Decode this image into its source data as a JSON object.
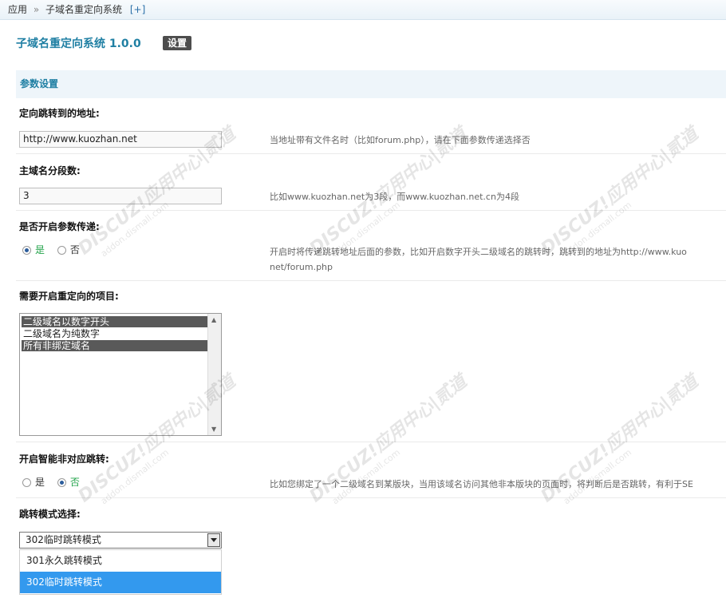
{
  "breadcrumb": {
    "root": "应用",
    "separator": "»",
    "current": "子域名重定向系统",
    "add": "[+]"
  },
  "header": {
    "title": "子域名重定向系统 1.0.0",
    "settings_label": "设置"
  },
  "section": {
    "title": "参数设置"
  },
  "fields": {
    "redirect_url": {
      "label": "定向跳转到的地址:",
      "value": "http://www.kuozhan.net",
      "hint": "当地址带有文件名时（比如forum.php），请在下面参数传递选择否"
    },
    "domain_segments": {
      "label": "主域名分段数:",
      "value": "3",
      "hint": "比如www.kuozhan.net为3段，而www.kuozhan.net.cn为4段"
    },
    "pass_params": {
      "label": "是否开启参数传递:",
      "yes": "是",
      "no": "否",
      "hint_line1": "开启时将传递跳转地址后面的参数，比如开启数字开头二级域名的跳转时，跳转到的地址为http://www.kuo",
      "hint_line2": "net/forum.php"
    },
    "redirect_items": {
      "label": "需要开启重定向的项目:",
      "options": [
        "二级域名以数字开头",
        "二级域名为纯数字",
        "所有非绑定域名"
      ]
    },
    "smart_redirect": {
      "label": "开启智能非对应跳转:",
      "yes": "是",
      "no": "否",
      "hint": "比如您绑定了一个二级域名到某版块，当用该域名访问其他非本版块的页面时，将判断后是否跳转，有利于SE"
    },
    "redirect_mode": {
      "label": "跳转模式选择:",
      "selected": "302临时跳转模式",
      "options": [
        "301永久跳转模式",
        "302临时跳转模式"
      ]
    }
  },
  "watermark": {
    "brand": "DISCUZ!应用中心|贰道",
    "url": "addon.dismall.com"
  }
}
